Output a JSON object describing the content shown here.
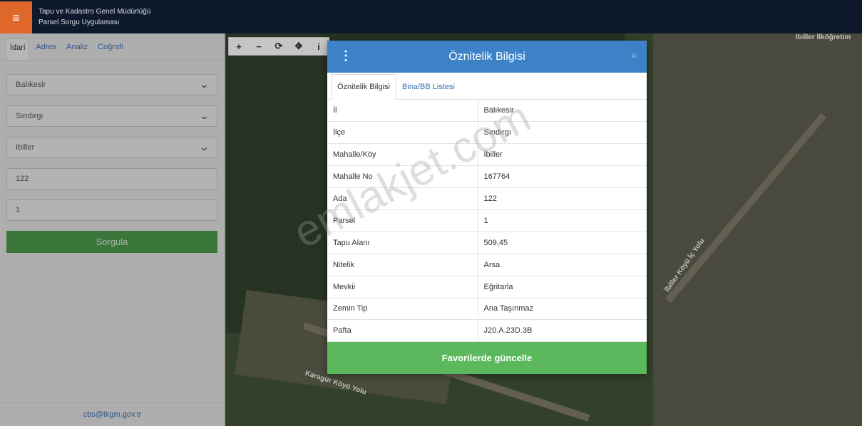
{
  "header": {
    "menu_icon": "hamburger-icon",
    "title_line1": "Tapu ve Kadastro Genel Müdürlüğü",
    "title_line2": "Parsel Sorgu Uygulaması"
  },
  "sidebar": {
    "tabs": [
      {
        "label": "İdari",
        "active": true
      },
      {
        "label": "Adres"
      },
      {
        "label": "Analiz"
      },
      {
        "label": "Coğrafi"
      }
    ],
    "province": "Balıkesir",
    "district": "Sındırgı",
    "neighborhood": "Ibiller",
    "block": "122",
    "parcel": "1",
    "query_button": "Sorgula",
    "footer_email": "cbs@tkgm.gov.tr"
  },
  "map": {
    "tools": [
      "+",
      "−",
      "⟳",
      "✥",
      "i"
    ],
    "road_labels": [
      "Karagür Köyü Yolu",
      "İbiller Köyü İç Yolu",
      "İbiller İlköğretim"
    ]
  },
  "modal": {
    "title": "Öznitelik Bilgisi",
    "close": "×",
    "tabs": [
      {
        "label": "Öznitelik Bilgisi",
        "active": true
      },
      {
        "label": "Bina/BB Listesi"
      }
    ],
    "rows": [
      {
        "key": "İl",
        "value": "Balıkesir"
      },
      {
        "key": "İlçe",
        "value": "Sındırgı"
      },
      {
        "key": "Mahalle/Köy",
        "value": "İbiller"
      },
      {
        "key": "Mahalle No",
        "value": "167764"
      },
      {
        "key": "Ada",
        "value": "122"
      },
      {
        "key": "Parsel",
        "value": "1"
      },
      {
        "key": "Tapu Alanı",
        "value": "509,45"
      },
      {
        "key": "Nitelik",
        "value": "Arsa"
      },
      {
        "key": "Mevkii",
        "value": "Eğritarla"
      },
      {
        "key": "Zemin Tip",
        "value": "Ana Taşınmaz"
      },
      {
        "key": "Pafta",
        "value": "J20.A.23D.3B"
      }
    ],
    "favorite_button": "Favorilerde güncelle"
  },
  "watermark": "emlakjet.com"
}
